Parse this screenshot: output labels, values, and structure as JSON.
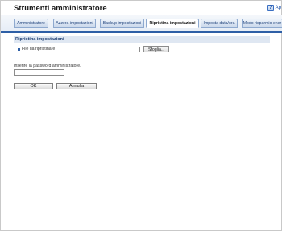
{
  "header": {
    "title": "Strumenti amministratore",
    "help_label": "Ap"
  },
  "tabs": [
    {
      "label": "Amministratore"
    },
    {
      "label": "Azzera impostazioni"
    },
    {
      "label": "Backup impostazioni"
    },
    {
      "label": "Ripristina impostazioni"
    },
    {
      "label": "Imposta data/ora"
    },
    {
      "label": "Modo risparmio ener"
    }
  ],
  "active_tab_index": 3,
  "section": {
    "title": "Ripristina impostazioni",
    "file_label": "File da ripristinare",
    "file_value": "",
    "browse_label": "Sfoglia..."
  },
  "password": {
    "label": "Inserire la password amministratore.",
    "value": ""
  },
  "actions": {
    "ok_label": "OK",
    "cancel_label": "Annulla"
  },
  "colors": {
    "accent": "#2e5fa6",
    "section_bg": "#dfe7f2"
  }
}
